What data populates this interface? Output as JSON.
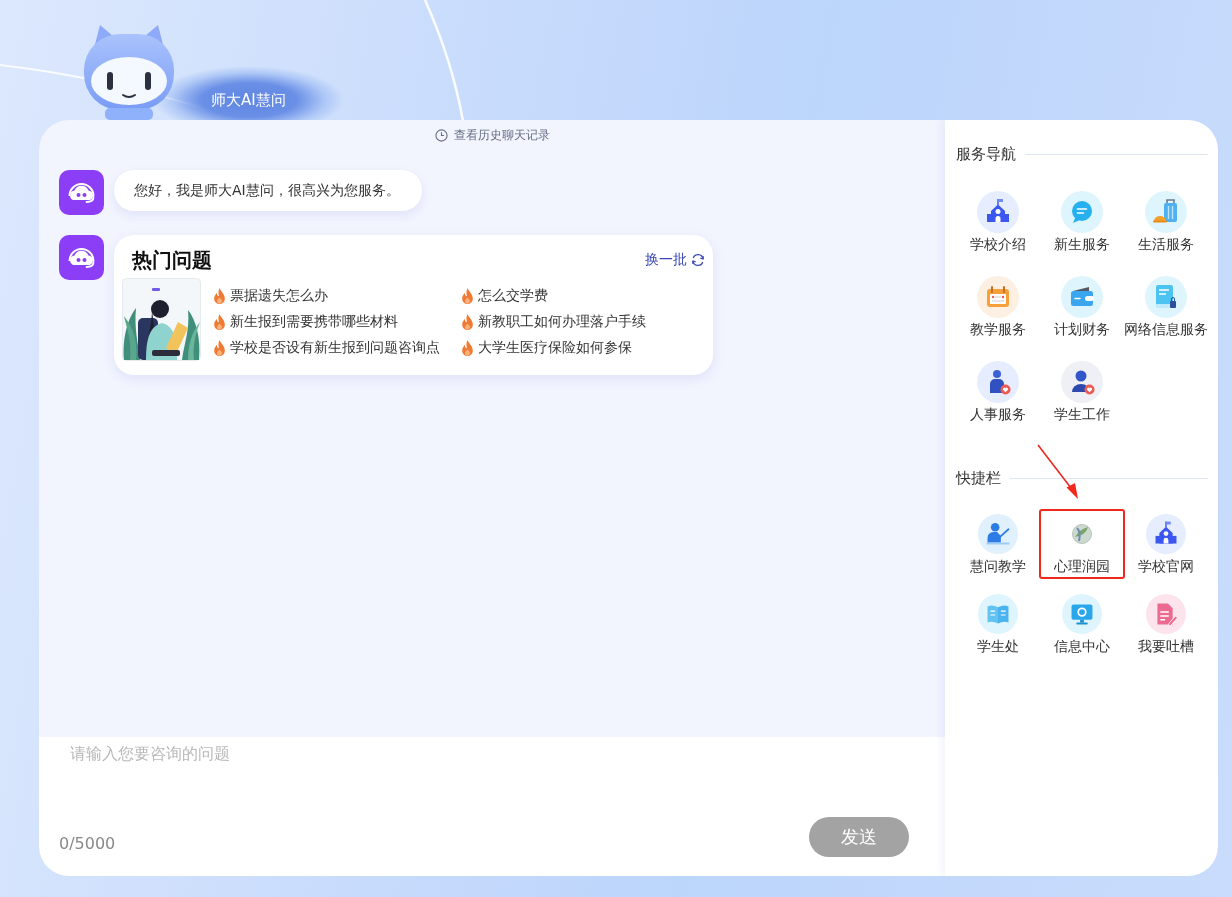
{
  "header": {
    "title": "师大AI慧问"
  },
  "chat": {
    "history_link": "查看历史聊天记录",
    "messages": [
      {
        "kind": "text",
        "text": "您好，我是师大AI慧问，很高兴为您服务。"
      },
      {
        "kind": "hot_questions",
        "title": "热门问题",
        "refresh": "换一批",
        "questions": [
          "票据遗失怎么办",
          "怎么交学费",
          "新生报到需要携带哪些材料",
          "新教职工如何办理落户手续",
          "学校是否设有新生报到问题咨询点",
          "大学生医疗保险如何参保"
        ]
      }
    ]
  },
  "composer": {
    "placeholder": "请输入您要咨询的问题",
    "counter": "0/5000",
    "send_button": {
      "label": "发送",
      "disabled": true
    }
  },
  "side_panel": {
    "sections": [
      {
        "title": "服务导航",
        "items": [
          {
            "label": "学校介绍"
          },
          {
            "label": "新生服务"
          },
          {
            "label": "生活服务"
          },
          {
            "label": "教学服务"
          },
          {
            "label": "计划财务"
          },
          {
            "label": "网络信息服务"
          },
          {
            "label": "人事服务"
          },
          {
            "label": "学生工作"
          }
        ]
      },
      {
        "title": "快捷栏",
        "items": [
          {
            "label": "慧问教学",
            "highlighted": false
          },
          {
            "label": "心理润园",
            "highlighted": true
          },
          {
            "label": "学校官网",
            "highlighted": false
          },
          {
            "label": "学生处",
            "highlighted": false
          },
          {
            "label": "信息中心",
            "highlighted": false
          },
          {
            "label": "我要吐槽",
            "highlighted": false
          }
        ]
      }
    ]
  }
}
